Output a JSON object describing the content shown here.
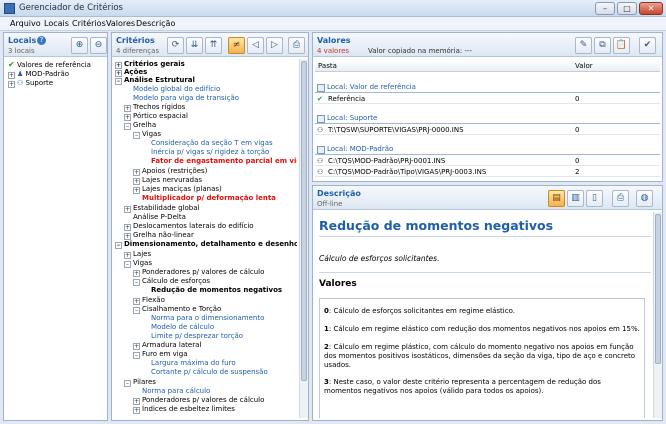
{
  "window": {
    "title": "Gerenciador de Critérios"
  },
  "menu": [
    "Arquivo",
    "Locais",
    "Critérios",
    "Valores",
    "Descrição"
  ],
  "locais": {
    "title": "Locais",
    "count": "3 locais",
    "items": [
      "Valores de referência",
      "MOD-Padrão",
      "Suporte"
    ]
  },
  "criterios": {
    "title": "Critérios",
    "count": "4 diferenças",
    "tree": [
      "Critérios gerais",
      "Ações",
      "Análise Estrutural",
      "Modelo global do edifício",
      "Modelo para viga de transição",
      "Trechos rígidos",
      "Pórtico espacial",
      "Grelha",
      "Vigas",
      "Consideração da seção T em vigas",
      "Inércia p/ vigas s/ rigidez à torção",
      "Fator de engastamento parcial em vigas",
      "Apoios (restrições)",
      "Lajes nervuradas",
      "Lajes maciças (planas)",
      "Multiplicador p/ deformação lenta",
      "Estabilidade global",
      "Análise P-Delta",
      "Deslocamentos laterais do edifício",
      "Grelha não-linear",
      "Dimensionamento, detalhamento e desenho",
      "Lajes",
      "Vigas",
      "Ponderadores p/ valores de cálculo",
      "Cálculo de esforços",
      "Redução de momentos negativos",
      "Flexão",
      "Cisalhamento e Torção",
      "Norma para o dimensionamento",
      "Modelo de cálculo",
      "Limite p/ desprezar torção",
      "Armadura lateral",
      "Furo em viga",
      "Largura máxima do furo",
      "Cortante p/ cálculo de suspensão",
      "Pilares",
      "Norma para cálculo",
      "Ponderadores p/ valores de cálculo",
      "Índices de esbeltez limites"
    ]
  },
  "valores": {
    "title": "Valores",
    "count": "4 valores",
    "memory": "Valor copiado na memória: ---",
    "col_path": "Pasta",
    "col_value": "Valor",
    "groups": [
      {
        "label": "Local: Valor de referência",
        "rows": [
          {
            "path": "Referência",
            "value": "0"
          }
        ]
      },
      {
        "label": "Local: Suporte",
        "rows": [
          {
            "path": "T:\\TQSW\\SUPORTE\\VIGAS\\PRJ-0000.INS",
            "value": "0"
          }
        ]
      },
      {
        "label": "Local: MOD-Padrão",
        "rows": [
          {
            "path": "C:\\TQS\\MOD-Padrão\\PRJ-0001.INS",
            "value": "0"
          },
          {
            "path": "C:\\TQS\\MOD-Padrão\\Tipo\\VIGAS\\PRJ-0003.INS",
            "value": "2"
          }
        ]
      }
    ]
  },
  "descricao": {
    "title": "Descrição",
    "status": "Off-line",
    "heading": "Redução de momentos negativos",
    "subtitle": "Cálculo de esforços solicitantes.",
    "section": "Valores",
    "p0_key": "0",
    "p0": ": Cálculo de esforços solicitantes em regime elástico.",
    "p1_key": "1",
    "p1": ": Cálculo em regime elástico com redução dos momentos negativos nos apoios em 15%.",
    "p2_key": "2",
    "p2": ": Cálculo em regime plástico, com cálculo do momento negativo nos apoios em função dos momentos positivos isostáticos, dimensões da seção da viga, tipo de aço e concreto usados.",
    "p3_key": "3",
    "p3": ": Neste caso, o valor deste critério representa a percentagem de redução dos momentos negativos nos apoios (válido para todos os apoios)."
  }
}
